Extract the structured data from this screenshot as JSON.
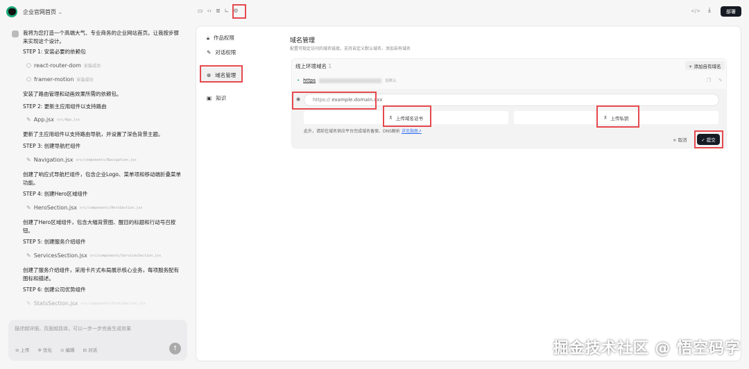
{
  "app": {
    "title": "企业官网首页"
  },
  "chat": {
    "intro": "我将为您打造一个高端大气、专业商务的企业网站首页。让我按步骤来实现这个设计。",
    "items": [
      {
        "type": "step",
        "text": "STEP 1: 安装必要的依赖包"
      },
      {
        "type": "pkg",
        "name": "react-router-dom",
        "status": "安装成功"
      },
      {
        "type": "pkg",
        "name": "framer-motion",
        "status": "安装成功"
      },
      {
        "type": "text",
        "text": "安装了路由管理和动画效果所需的依赖包。"
      },
      {
        "type": "step",
        "text": "STEP 2: 更新主应用组件以支持路由"
      },
      {
        "type": "file",
        "name": "App.jsx",
        "path": "src/App.jsx"
      },
      {
        "type": "text",
        "text": "更新了主应用组件以支持路由导航，并设置了深色背景主题。"
      },
      {
        "type": "step",
        "text": "STEP 3: 创建导航栏组件"
      },
      {
        "type": "file",
        "name": "Navigation.jsx",
        "path": "src/components/Navigation.jsx"
      },
      {
        "type": "text",
        "text": "创建了响应式导航栏组件，包含企业Logo、菜单项和移动端折叠菜单功能。"
      },
      {
        "type": "step",
        "text": "STEP 4: 创建Hero区域组件"
      },
      {
        "type": "file",
        "name": "HeroSection.jsx",
        "path": "src/components/HeroSection.jsx"
      },
      {
        "type": "text",
        "text": "创建了Hero区域组件，包含大幅背景图、醒目的标题和行动号召按钮。"
      },
      {
        "type": "step",
        "text": "STEP 5: 创建服务介绍组件"
      },
      {
        "type": "file",
        "name": "ServicesSection.jsx",
        "path": "src/components/ServicesSection.jsx"
      },
      {
        "type": "text",
        "text": "创建了服务介绍组件，采用卡片式布局展示核心业务，每项服务配有图标和描述。"
      },
      {
        "type": "step",
        "text": "STEP 6: 创建公司优势组件"
      },
      {
        "type": "file",
        "name": "StatsSection.jsx",
        "path": "src/components/StatsSection.jsx"
      }
    ],
    "input_placeholder": "描述越详细，页面越具体，可以一步一步完善生成效果",
    "actions": [
      "上传",
      "优化",
      "编辑",
      "对话"
    ]
  },
  "toolbar": {
    "code": "</>",
    "deploy": "部署"
  },
  "settings": {
    "nav": [
      "作品权限",
      "对话权限",
      "域名管理",
      "知识"
    ],
    "title": "域名管理",
    "subtitle": "配置可稳定访问的域名链接，支持自定义默认域名、添加自有域名",
    "env_label": "线上环境域名",
    "env_count": "1",
    "add_domain": "+ 添加自有域名",
    "domain_prefix": "https",
    "domain_default": "设默认",
    "input_prefix": "https://",
    "input_placeholder": "example.domain.xxx",
    "upload_cert": "上传域名证书",
    "upload_key": "上传私钥",
    "note": "此外，请前往域名供应平台完成域名备案、DNS解析",
    "note_link": "详见指南↗",
    "cancel": "× 取消",
    "submit": "✓ 提交"
  },
  "watermark": "掘金技术社区 @ 悟空码字"
}
